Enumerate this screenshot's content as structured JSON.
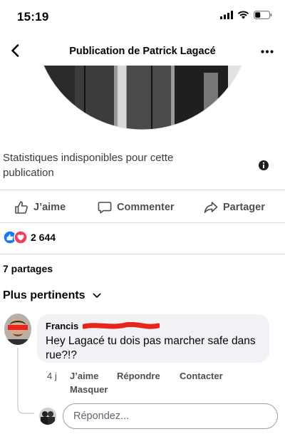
{
  "status_bar": {
    "time": "15:19"
  },
  "header": {
    "title": "Publication de Patrick Lagacé"
  },
  "post": {
    "stats_unavailable": "Statistiques indisponibles pour cette publication",
    "actions": {
      "like": "J’aime",
      "comment": "Commenter",
      "share": "Partager"
    },
    "reaction_count": "2 644",
    "shares": "7 partages"
  },
  "comments": {
    "sort_label": "Plus pertinents",
    "items": [
      {
        "author": "Francis",
        "text": "Hey Lagacé tu dois pas marcher safe dans rue?!?",
        "time": "4 j",
        "actions": {
          "like": "J’aime",
          "reply": "Répondre",
          "contact": "Contacter",
          "hide": "Masquer"
        }
      }
    ],
    "reply_placeholder": "Répondez..."
  },
  "colors": {
    "like_blue": "#1877f2",
    "love_red": "#f33e58",
    "redaction_red": "#e8241c"
  }
}
